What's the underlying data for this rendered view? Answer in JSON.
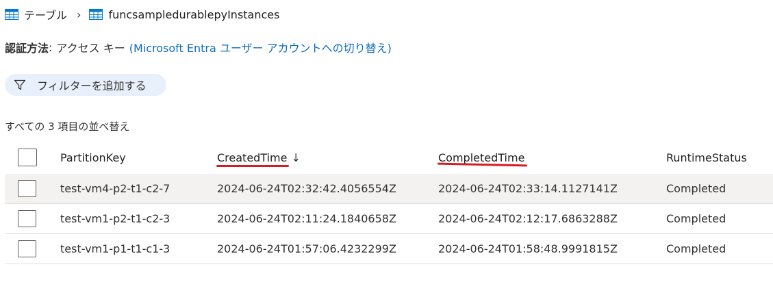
{
  "breadcrumb": {
    "root_label": "テーブル",
    "separator": "›",
    "current_label": "funcsampledurablepyInstances",
    "icon": "table-icon"
  },
  "auth": {
    "label": "認証方法",
    "colon": ":",
    "value": "アクセス キー",
    "link": "(Microsoft Entra ユーザー アカウントへの切り替え)"
  },
  "filter": {
    "label": "フィルターを追加する",
    "icon": "filter-icon"
  },
  "sort_info": "すべての 3 項目の並べ替え",
  "table": {
    "columns": {
      "partition_key": "PartitionKey",
      "created_time": "CreatedTime",
      "created_sort_indicator": "↓",
      "completed_time": "CompletedTime",
      "runtime_status": "RuntimeStatus"
    },
    "rows": [
      {
        "partition_key": "test-vm4-p2-t1-c2-7",
        "created_time": "2024-06-24T02:32:42.4056554Z",
        "completed_time": "2024-06-24T02:33:14.1127141Z",
        "runtime_status": "Completed"
      },
      {
        "partition_key": "test-vm1-p2-t1-c2-3",
        "created_time": "2024-06-24T02:11:24.1840658Z",
        "completed_time": "2024-06-24T02:12:17.6863288Z",
        "runtime_status": "Completed"
      },
      {
        "partition_key": "test-vm1-p1-t1-c1-3",
        "created_time": "2024-06-24T01:57:06.4232299Z",
        "completed_time": "2024-06-24T01:58:48.9991815Z",
        "runtime_status": "Completed"
      }
    ]
  },
  "colors": {
    "link": "#0f6cbd",
    "filter_bg": "#e8f0fb",
    "annotation_red": "#d81b23",
    "row_highlight": "#f3f2f1",
    "table_icon_blue": "#0078d4"
  }
}
